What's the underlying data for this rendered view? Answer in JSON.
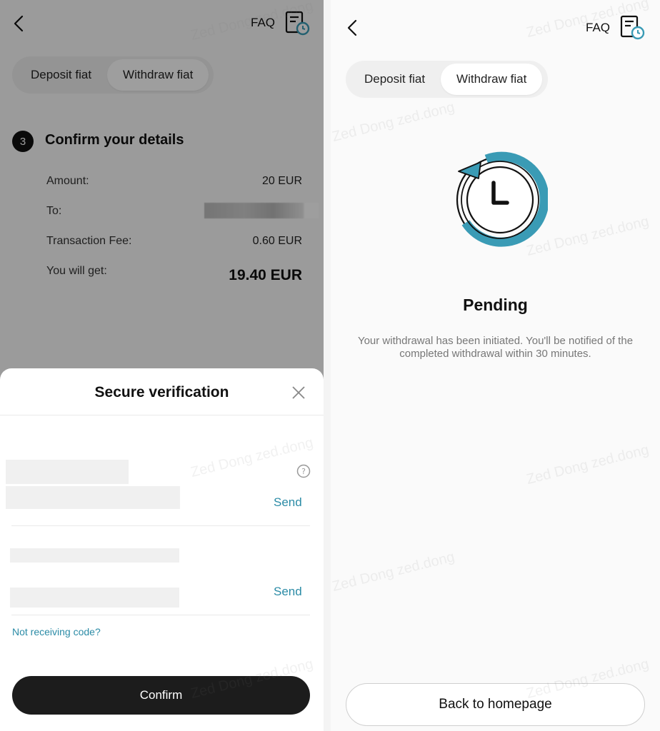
{
  "left": {
    "faq_label": "FAQ",
    "tabs": [
      {
        "label": "Deposit fiat",
        "active": false
      },
      {
        "label": "Withdraw fiat",
        "active": true
      }
    ],
    "step": {
      "number": "3",
      "title": "Confirm your details",
      "rows": [
        {
          "label": "Amount:",
          "value": "20 EUR"
        },
        {
          "label": "To:",
          "value": ""
        },
        {
          "label": "Transaction Fee:",
          "value": "0.60 EUR"
        },
        {
          "label": "You will get:",
          "value": "19.40 EUR"
        }
      ]
    },
    "sheet": {
      "title": "Secure verification",
      "send_label_1": "Send",
      "send_label_2": "Send",
      "not_receiving": "Not receiving code?",
      "confirm_label": "Confirm"
    }
  },
  "right": {
    "faq_label": "FAQ",
    "tabs": [
      {
        "label": "Deposit fiat",
        "active": false
      },
      {
        "label": "Withdraw fiat",
        "active": true
      }
    ],
    "status_title": "Pending",
    "status_message": "Your withdrawal has been initiated. You'll be notified of the completed withdrawal within 30 minutes.",
    "home_button": "Back to homepage"
  },
  "watermark": "Zed Dong zed.dong",
  "colors": {
    "accent": "#2b8ba6",
    "icon_teal": "#3a9bb5",
    "dark_button": "#1c1c1c"
  }
}
